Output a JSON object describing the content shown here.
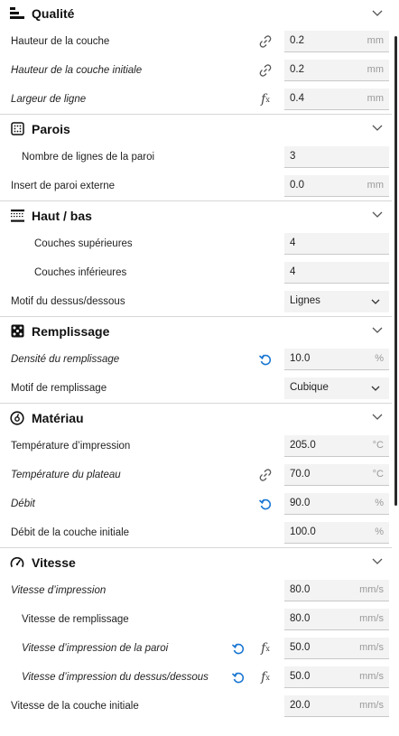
{
  "colors": {
    "accent": "#1976d2",
    "icon": "#555555"
  },
  "sections": {
    "quality": {
      "title": "Qualité",
      "layer_height": {
        "label": "Hauteur de la couche",
        "value": "0.2",
        "unit": "mm"
      },
      "initial_layer_height": {
        "label": "Hauteur de la couche initiale",
        "value": "0.2",
        "unit": "mm"
      },
      "line_width": {
        "label": "Largeur de ligne",
        "value": "0.4",
        "unit": "mm"
      }
    },
    "walls": {
      "title": "Parois",
      "wall_line_count": {
        "label": "Nombre de lignes de la paroi",
        "value": "3",
        "unit": ""
      },
      "outer_wall_inset": {
        "label": "Insert de paroi externe",
        "value": "0.0",
        "unit": "mm"
      }
    },
    "top_bottom": {
      "title": "Haut / bas",
      "top_layers": {
        "label": "Couches supérieures",
        "value": "4",
        "unit": ""
      },
      "bottom_layers": {
        "label": "Couches inférieures",
        "value": "4",
        "unit": ""
      },
      "pattern": {
        "label": "Motif du dessus/dessous",
        "value": "Lignes"
      }
    },
    "infill": {
      "title": "Remplissage",
      "density": {
        "label": "Densité du remplissage",
        "value": "10.0",
        "unit": "%"
      },
      "pattern": {
        "label": "Motif de remplissage",
        "value": "Cubique"
      }
    },
    "material": {
      "title": "Matériau",
      "print_temp": {
        "label": "Température d’impression",
        "value": "205.0",
        "unit": "°C"
      },
      "bed_temp": {
        "label": "Température du plateau",
        "value": "70.0",
        "unit": "°C"
      },
      "flow": {
        "label": "Débit",
        "value": "90.0",
        "unit": "%"
      },
      "initial_flow": {
        "label": "Débit de la couche initiale",
        "value": "100.0",
        "unit": "%"
      }
    },
    "speed": {
      "title": "Vitesse",
      "print_speed": {
        "label": "Vitesse d’impression",
        "value": "80.0",
        "unit": "mm/s"
      },
      "infill_speed": {
        "label": "Vitesse de remplissage",
        "value": "80.0",
        "unit": "mm/s"
      },
      "wall_speed": {
        "label": "Vitesse d’impression de la paroi",
        "value": "50.0",
        "unit": "mm/s"
      },
      "topbottom_speed": {
        "label": "Vitesse d’impression du dessus/dessous",
        "value": "50.0",
        "unit": "mm/s"
      },
      "initial_layer_speed": {
        "label": "Vitesse de la couche initiale",
        "value": "20.0",
        "unit": "mm/s"
      }
    }
  }
}
